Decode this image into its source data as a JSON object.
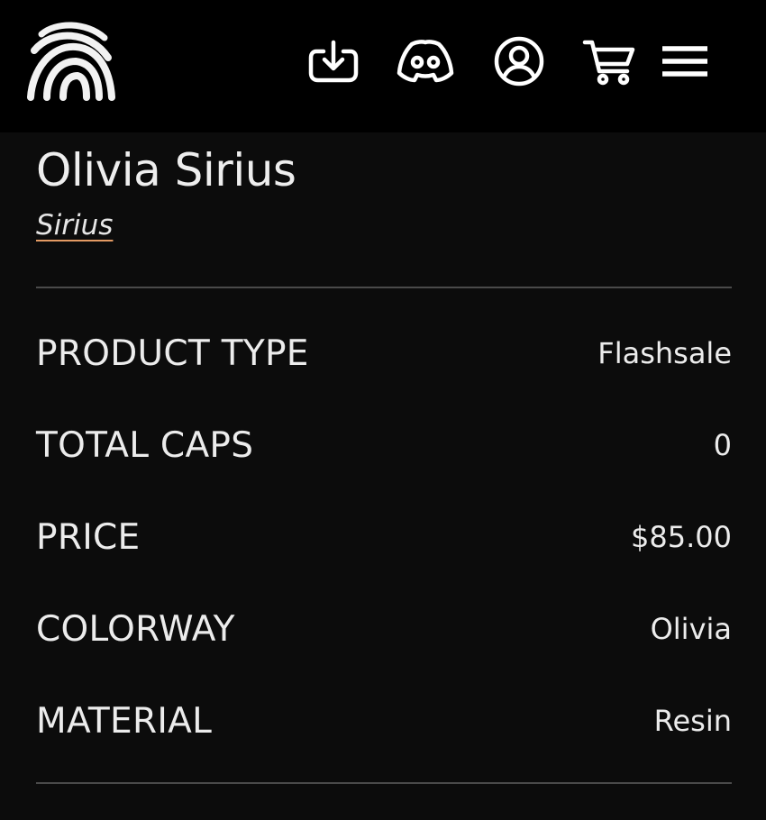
{
  "header": {
    "icons": [
      "fingerprint-logo-icon",
      "download-icon",
      "discord-icon",
      "account-icon",
      "cart-icon",
      "menu-icon"
    ]
  },
  "product": {
    "title": "Olivia Sirius",
    "collection_link": "Sirius"
  },
  "specs": [
    {
      "label": "PRODUCT TYPE",
      "value": "Flashsale"
    },
    {
      "label": "TOTAL CAPS",
      "value": "0"
    },
    {
      "label": "PRICE",
      "value": "$85.00"
    },
    {
      "label": "COLORWAY",
      "value": "Olivia"
    },
    {
      "label": "MATERIAL",
      "value": "Resin"
    }
  ],
  "colors": {
    "background": "#0c0c0c",
    "header": "#000000",
    "text": "#ececec",
    "link_underline": "#e39a63",
    "divider": "#4a4a4a"
  }
}
